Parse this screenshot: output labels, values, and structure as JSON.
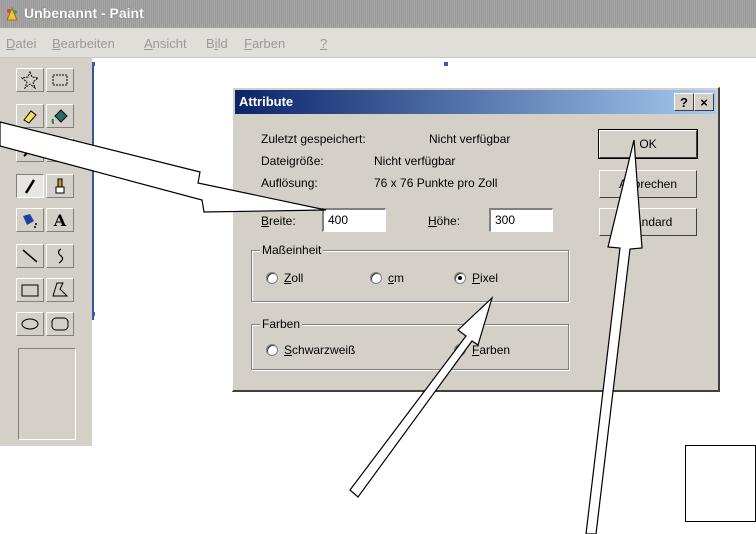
{
  "window": {
    "title": "Unbenannt - Paint"
  },
  "menu": [
    {
      "label": "Datei",
      "mnemonic": "D"
    },
    {
      "label": "Bearbeiten",
      "mnemonic": "B"
    },
    {
      "label": "Ansicht",
      "mnemonic": "A"
    },
    {
      "label": "Bild",
      "mnemonic": "i"
    },
    {
      "label": "Farben",
      "mnemonic": "F"
    },
    {
      "label": "?",
      "mnemonic": "?"
    }
  ],
  "tools": [
    {
      "name": "free-select",
      "icon": "star-select-icon"
    },
    {
      "name": "rect-select",
      "icon": "rect-select-icon"
    },
    {
      "name": "eraser",
      "icon": "eraser-icon"
    },
    {
      "name": "fill",
      "icon": "fill-bucket-icon"
    },
    {
      "name": "color-picker",
      "icon": "eyedropper-icon"
    },
    {
      "name": "magnifier",
      "icon": "magnifier-icon"
    },
    {
      "name": "pencil",
      "icon": "pencil-icon",
      "pressed": true
    },
    {
      "name": "brush",
      "icon": "brush-icon"
    },
    {
      "name": "airbrush",
      "icon": "airbrush-icon"
    },
    {
      "name": "text",
      "icon": "text-icon",
      "glyph": "A"
    },
    {
      "name": "line",
      "icon": "line-icon"
    },
    {
      "name": "curve",
      "icon": "curve-icon"
    },
    {
      "name": "rectangle",
      "icon": "rectangle-icon"
    },
    {
      "name": "polygon",
      "icon": "polygon-icon"
    },
    {
      "name": "ellipse",
      "icon": "ellipse-icon"
    },
    {
      "name": "rounded-rectangle",
      "icon": "rounded-rectangle-icon"
    }
  ],
  "dialog": {
    "title": "Attribute",
    "help_btn": "?",
    "close_btn": "×",
    "info": {
      "saved_label": "Zuletzt gespeichert:",
      "saved_value": "Nicht verfügbar",
      "size_label": "Dateigröße:",
      "size_value": "Nicht verfügbar",
      "res_label": "Auflösung:",
      "res_value": "76 x 76 Punkte pro Zoll"
    },
    "width": {
      "label_mn": "B",
      "label_rest": "reite:",
      "value": "400"
    },
    "height": {
      "label_mn": "H",
      "label_rest": "öhe:",
      "value": "300"
    },
    "units": {
      "title": "Maßeinheit",
      "options": [
        {
          "mn": "Z",
          "rest": "oll",
          "selected": false
        },
        {
          "mn": "c",
          "rest": "m",
          "selected": false
        },
        {
          "mn": "P",
          "rest": "ixel",
          "selected": true
        }
      ]
    },
    "colors": {
      "title": "Farben",
      "options": [
        {
          "mn": "S",
          "rest": "chwarzweiß",
          "selected": false
        },
        {
          "mn": "F",
          "rest": "arben",
          "selected": true
        }
      ]
    },
    "buttons": {
      "ok": "OK",
      "cancel": "Abbrechen",
      "default_mn": "S",
      "default_rest": "tandard"
    }
  }
}
